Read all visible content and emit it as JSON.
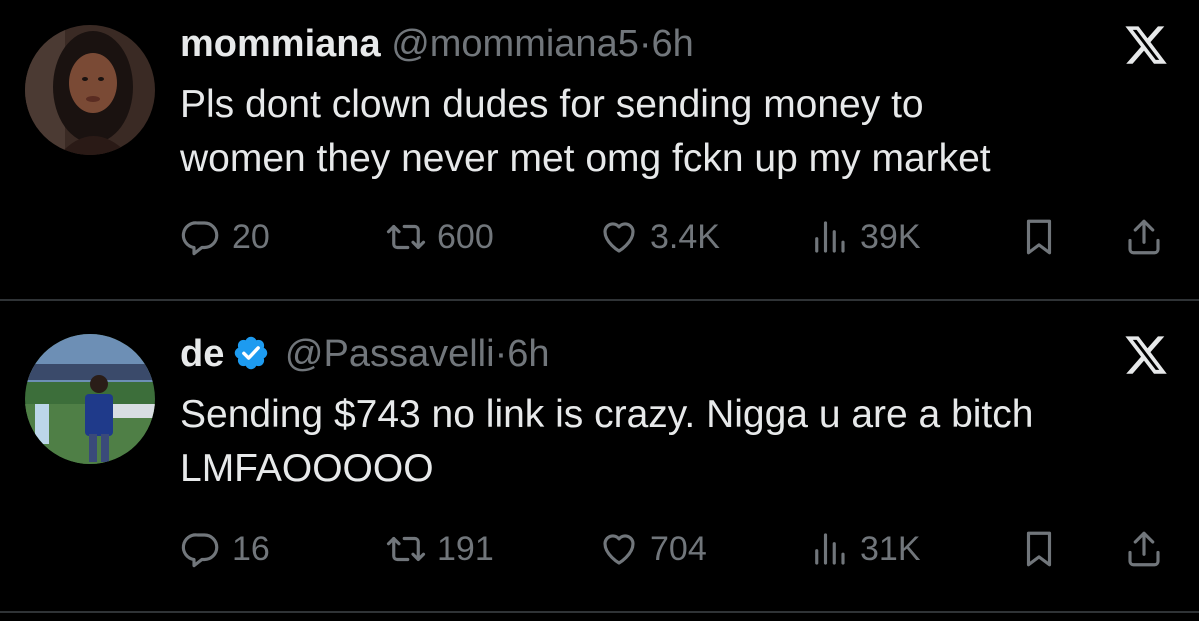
{
  "tweets": [
    {
      "author_name": "mommiana",
      "author_handle": "@mommiana5",
      "separator": "·",
      "time": "6h",
      "verified": false,
      "text": "Pls dont clown dudes for sending money to\nwomen they never met omg fckn up my market",
      "replies": "20",
      "retweets": "600",
      "likes": "3.4K",
      "views": "39K"
    },
    {
      "author_name": "de",
      "author_handle": "@Passavelli",
      "separator": "·",
      "time": "6h",
      "verified": true,
      "text": "Sending $743 no link is crazy. Nigga u are a bitch\nLMFAOOOOO",
      "replies": "16",
      "retweets": "191",
      "likes": "704",
      "views": "31K"
    }
  ],
  "colors": {
    "background": "#000000",
    "primary_text": "#e7e9ea",
    "secondary_text": "#71767b",
    "divider": "#2f3336",
    "verified_badge": "#1d9bf0"
  },
  "icons": {
    "platform": "x-logo-icon",
    "reply": "reply-icon",
    "retweet": "retweet-icon",
    "like": "heart-icon",
    "views": "views-icon",
    "bookmark": "bookmark-icon",
    "share": "share-icon"
  }
}
